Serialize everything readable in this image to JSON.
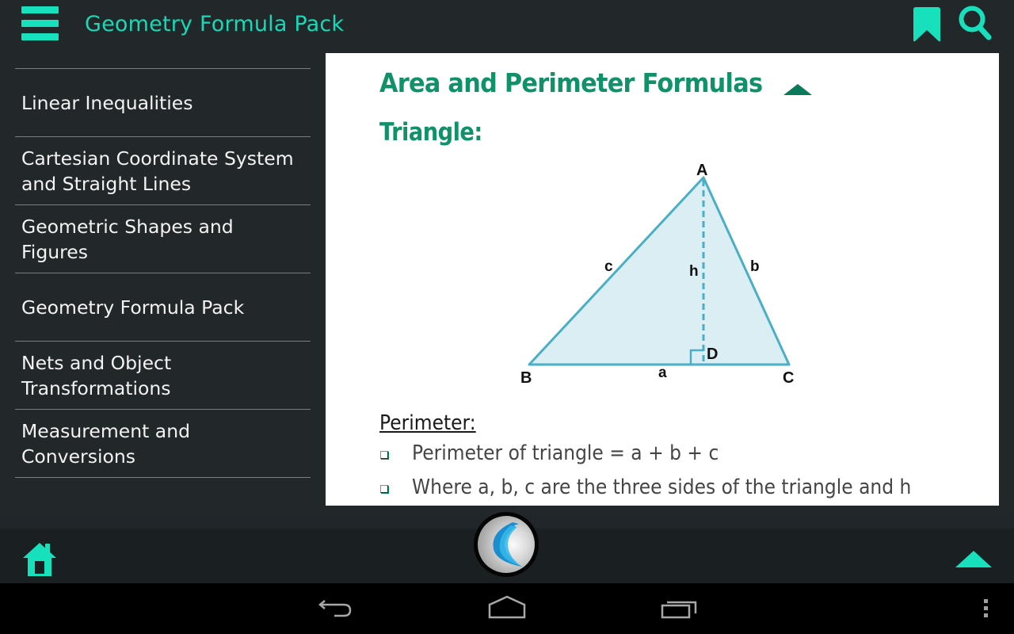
{
  "appbar": {
    "title": "Geometry Formula Pack",
    "menu_icon": "hamburger-menu-icon",
    "bookmark_icon": "bookmark-icon",
    "search_icon": "search-icon",
    "accent_color": "#17e0bd"
  },
  "sidebar": {
    "items": [
      {
        "label": "Linear Inequalities"
      },
      {
        "label": "Cartesian Coordinate System and Straight Lines"
      },
      {
        "label": "Geometric Shapes and Figures"
      },
      {
        "label": "Geometry Formula Pack"
      },
      {
        "label": "Nets and Object Transformations"
      },
      {
        "label": "Measurement and Conversions"
      }
    ]
  },
  "content": {
    "section_title": "Area and Perimeter Formulas",
    "collapse_icon": "collapse-up-icon",
    "subtitle": "Triangle:",
    "heading_color": "#10916a",
    "diagram": {
      "vertex_labels": {
        "A": "A",
        "B": "B",
        "C": "C",
        "D": "D"
      },
      "side_labels": {
        "a": "a",
        "b": "b",
        "c": "c",
        "h": "h"
      },
      "stroke_color": "#4aafc6",
      "fill_color": "#dbeef4"
    },
    "perimeter_heading": "Perimeter:",
    "bullets": [
      {
        "text": "Perimeter of triangle = a + b + c"
      },
      {
        "text": "Where a, b, c are the three sides of the triangle and h"
      }
    ]
  },
  "bottombar": {
    "home_icon": "home-icon",
    "logo_icon": "app-logo-icon",
    "scroll_top_icon": "scroll-top-icon"
  },
  "system_nav": {
    "back_icon": "back-icon",
    "home_icon": "home-outline-icon",
    "recents_icon": "recent-apps-icon",
    "overflow_icon": "overflow-menu-icon"
  }
}
